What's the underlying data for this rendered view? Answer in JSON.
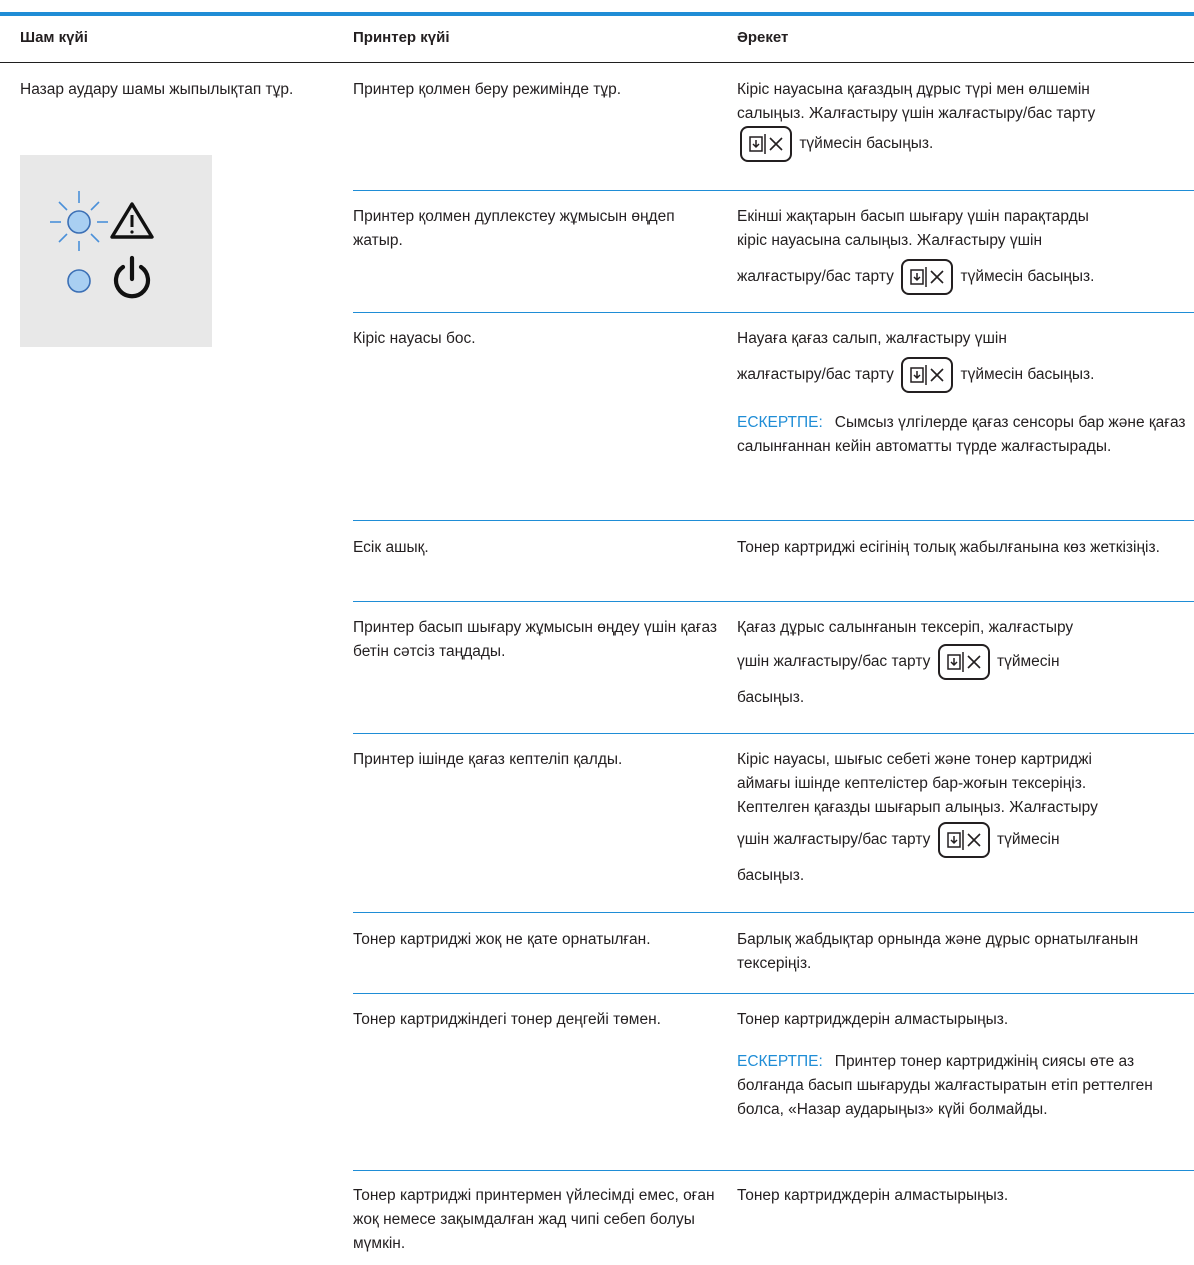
{
  "header": {
    "col1": "Шам күйі",
    "col2": "Принтер күйі",
    "col3": "Әрекет"
  },
  "light_state": {
    "text": "Назар аудару шамы жыпылықтап тұр.",
    "icons": [
      "attention-light-blinking-icon",
      "warning-triangle-icon",
      "power-light-icon",
      "power-symbol-icon"
    ]
  },
  "note_label": "ЕСКЕРТПЕ:",
  "rows": [
    {
      "condition": "Принтер қолмен беру режимінде тұр.",
      "action_l1": "Кіріс науасына қағаздың дұрыс түрі мен өлшемін",
      "action_l2": "салыңыз. Жалғастыру үшін жалғастыру/бас тарту",
      "action_l3": "түймесін басыңыз."
    },
    {
      "condition": "Принтер қолмен дуплекстеу жұмысын өңдеп жатыр.",
      "action_l1": "Екінші жақтарын басып шығару үшін парақтарды",
      "action_l2": "кіріс науасына салыңыз. Жалғастыру үшін",
      "action_l3a": "жалғастыру/бас тарту",
      "action_l3b": "түймесін басыңыз."
    },
    {
      "condition": "Кіріс науасы бос.",
      "action_l1": "Науаға қағаз салып, жалғастыру үшін",
      "action_l2a": "жалғастыру/бас тарту",
      "action_l2b": "түймесін басыңыз.",
      "note": "Сымсыз үлгілерде қағаз сенсоры бар және қағаз салынғаннан кейін автоматты түрде жалғастырады."
    },
    {
      "condition": "Есік ашық.",
      "action": "Тонер картриджі есігінің толық жабылғанына көз жеткізіңіз."
    },
    {
      "condition": "Принтер басып шығару жұмысын өңдеу үшін қағаз бетін сәтсіз таңдады.",
      "action_l1": "Қағаз дұрыс салынғанын тексеріп, жалғастыру",
      "action_l2a": "үшін жалғастыру/бас тарту",
      "action_l2b": "түймесін",
      "action_l3": "басыңыз."
    },
    {
      "condition": "Принтер ішінде қағаз кептеліп қалды.",
      "action_l1": "Кіріс науасы, шығыс себеті және тонер картриджі",
      "action_l2": "аймағы ішінде кептелістер бар-жоғын тексеріңіз.",
      "action_l3": "Кептелген қағазды шығарып алыңыз. Жалғастыру",
      "action_l4a": "үшін жалғастыру/бас тарту",
      "action_l4b": "түймесін",
      "action_l5": "басыңыз."
    },
    {
      "condition": "Тонер картриджі жоқ не қате орнатылған.",
      "action": "Барлық жабдықтар орнында және дұрыс орнатылғанын тексеріңіз."
    },
    {
      "condition": "Тонер картриджіндегі тонер деңгейі төмен.",
      "action": "Тонер картридждерін алмастырыңыз.",
      "note": "Принтер тонер картриджінің сиясы өте аз болғанда басып шығаруды жалғастыратын етіп реттелген болса, «Назар аударыңыз» күйі болмайды."
    },
    {
      "condition": "Тонер картриджі принтермен үйлесімді емес, оған жоқ немесе зақымдалған жад чипі себеп болуы мүмкін.",
      "action": "Тонер картридждерін алмастырыңыз."
    }
  ]
}
